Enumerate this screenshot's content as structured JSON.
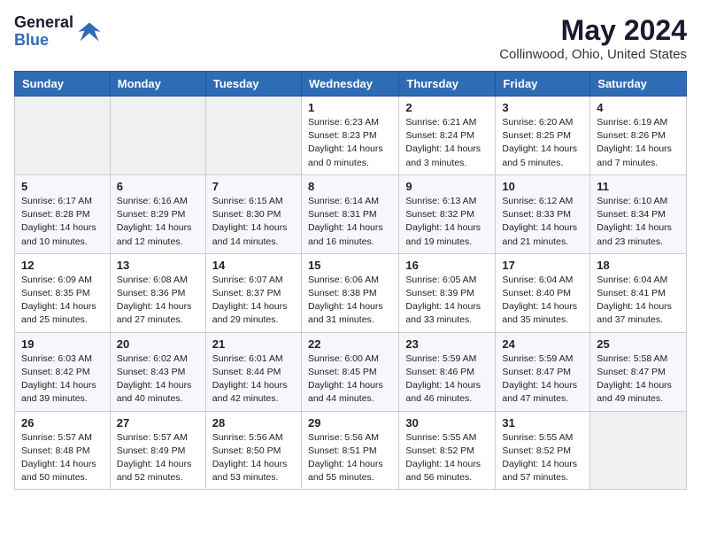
{
  "header": {
    "logo": {
      "general": "General",
      "blue": "Blue"
    },
    "title": "May 2024",
    "subtitle": "Collinwood, Ohio, United States"
  },
  "days_of_week": [
    "Sunday",
    "Monday",
    "Tuesday",
    "Wednesday",
    "Thursday",
    "Friday",
    "Saturday"
  ],
  "weeks": [
    [
      {
        "day": "",
        "content": ""
      },
      {
        "day": "",
        "content": ""
      },
      {
        "day": "",
        "content": ""
      },
      {
        "day": "1",
        "content": "Sunrise: 6:23 AM\nSunset: 8:23 PM\nDaylight: 14 hours and 0 minutes."
      },
      {
        "day": "2",
        "content": "Sunrise: 6:21 AM\nSunset: 8:24 PM\nDaylight: 14 hours and 3 minutes."
      },
      {
        "day": "3",
        "content": "Sunrise: 6:20 AM\nSunset: 8:25 PM\nDaylight: 14 hours and 5 minutes."
      },
      {
        "day": "4",
        "content": "Sunrise: 6:19 AM\nSunset: 8:26 PM\nDaylight: 14 hours and 7 minutes."
      }
    ],
    [
      {
        "day": "5",
        "content": "Sunrise: 6:17 AM\nSunset: 8:28 PM\nDaylight: 14 hours and 10 minutes."
      },
      {
        "day": "6",
        "content": "Sunrise: 6:16 AM\nSunset: 8:29 PM\nDaylight: 14 hours and 12 minutes."
      },
      {
        "day": "7",
        "content": "Sunrise: 6:15 AM\nSunset: 8:30 PM\nDaylight: 14 hours and 14 minutes."
      },
      {
        "day": "8",
        "content": "Sunrise: 6:14 AM\nSunset: 8:31 PM\nDaylight: 14 hours and 16 minutes."
      },
      {
        "day": "9",
        "content": "Sunrise: 6:13 AM\nSunset: 8:32 PM\nDaylight: 14 hours and 19 minutes."
      },
      {
        "day": "10",
        "content": "Sunrise: 6:12 AM\nSunset: 8:33 PM\nDaylight: 14 hours and 21 minutes."
      },
      {
        "day": "11",
        "content": "Sunrise: 6:10 AM\nSunset: 8:34 PM\nDaylight: 14 hours and 23 minutes."
      }
    ],
    [
      {
        "day": "12",
        "content": "Sunrise: 6:09 AM\nSunset: 8:35 PM\nDaylight: 14 hours and 25 minutes."
      },
      {
        "day": "13",
        "content": "Sunrise: 6:08 AM\nSunset: 8:36 PM\nDaylight: 14 hours and 27 minutes."
      },
      {
        "day": "14",
        "content": "Sunrise: 6:07 AM\nSunset: 8:37 PM\nDaylight: 14 hours and 29 minutes."
      },
      {
        "day": "15",
        "content": "Sunrise: 6:06 AM\nSunset: 8:38 PM\nDaylight: 14 hours and 31 minutes."
      },
      {
        "day": "16",
        "content": "Sunrise: 6:05 AM\nSunset: 8:39 PM\nDaylight: 14 hours and 33 minutes."
      },
      {
        "day": "17",
        "content": "Sunrise: 6:04 AM\nSunset: 8:40 PM\nDaylight: 14 hours and 35 minutes."
      },
      {
        "day": "18",
        "content": "Sunrise: 6:04 AM\nSunset: 8:41 PM\nDaylight: 14 hours and 37 minutes."
      }
    ],
    [
      {
        "day": "19",
        "content": "Sunrise: 6:03 AM\nSunset: 8:42 PM\nDaylight: 14 hours and 39 minutes."
      },
      {
        "day": "20",
        "content": "Sunrise: 6:02 AM\nSunset: 8:43 PM\nDaylight: 14 hours and 40 minutes."
      },
      {
        "day": "21",
        "content": "Sunrise: 6:01 AM\nSunset: 8:44 PM\nDaylight: 14 hours and 42 minutes."
      },
      {
        "day": "22",
        "content": "Sunrise: 6:00 AM\nSunset: 8:45 PM\nDaylight: 14 hours and 44 minutes."
      },
      {
        "day": "23",
        "content": "Sunrise: 5:59 AM\nSunset: 8:46 PM\nDaylight: 14 hours and 46 minutes."
      },
      {
        "day": "24",
        "content": "Sunrise: 5:59 AM\nSunset: 8:47 PM\nDaylight: 14 hours and 47 minutes."
      },
      {
        "day": "25",
        "content": "Sunrise: 5:58 AM\nSunset: 8:47 PM\nDaylight: 14 hours and 49 minutes."
      }
    ],
    [
      {
        "day": "26",
        "content": "Sunrise: 5:57 AM\nSunset: 8:48 PM\nDaylight: 14 hours and 50 minutes."
      },
      {
        "day": "27",
        "content": "Sunrise: 5:57 AM\nSunset: 8:49 PM\nDaylight: 14 hours and 52 minutes."
      },
      {
        "day": "28",
        "content": "Sunrise: 5:56 AM\nSunset: 8:50 PM\nDaylight: 14 hours and 53 minutes."
      },
      {
        "day": "29",
        "content": "Sunrise: 5:56 AM\nSunset: 8:51 PM\nDaylight: 14 hours and 55 minutes."
      },
      {
        "day": "30",
        "content": "Sunrise: 5:55 AM\nSunset: 8:52 PM\nDaylight: 14 hours and 56 minutes."
      },
      {
        "day": "31",
        "content": "Sunrise: 5:55 AM\nSunset: 8:52 PM\nDaylight: 14 hours and 57 minutes."
      },
      {
        "day": "",
        "content": ""
      }
    ]
  ]
}
